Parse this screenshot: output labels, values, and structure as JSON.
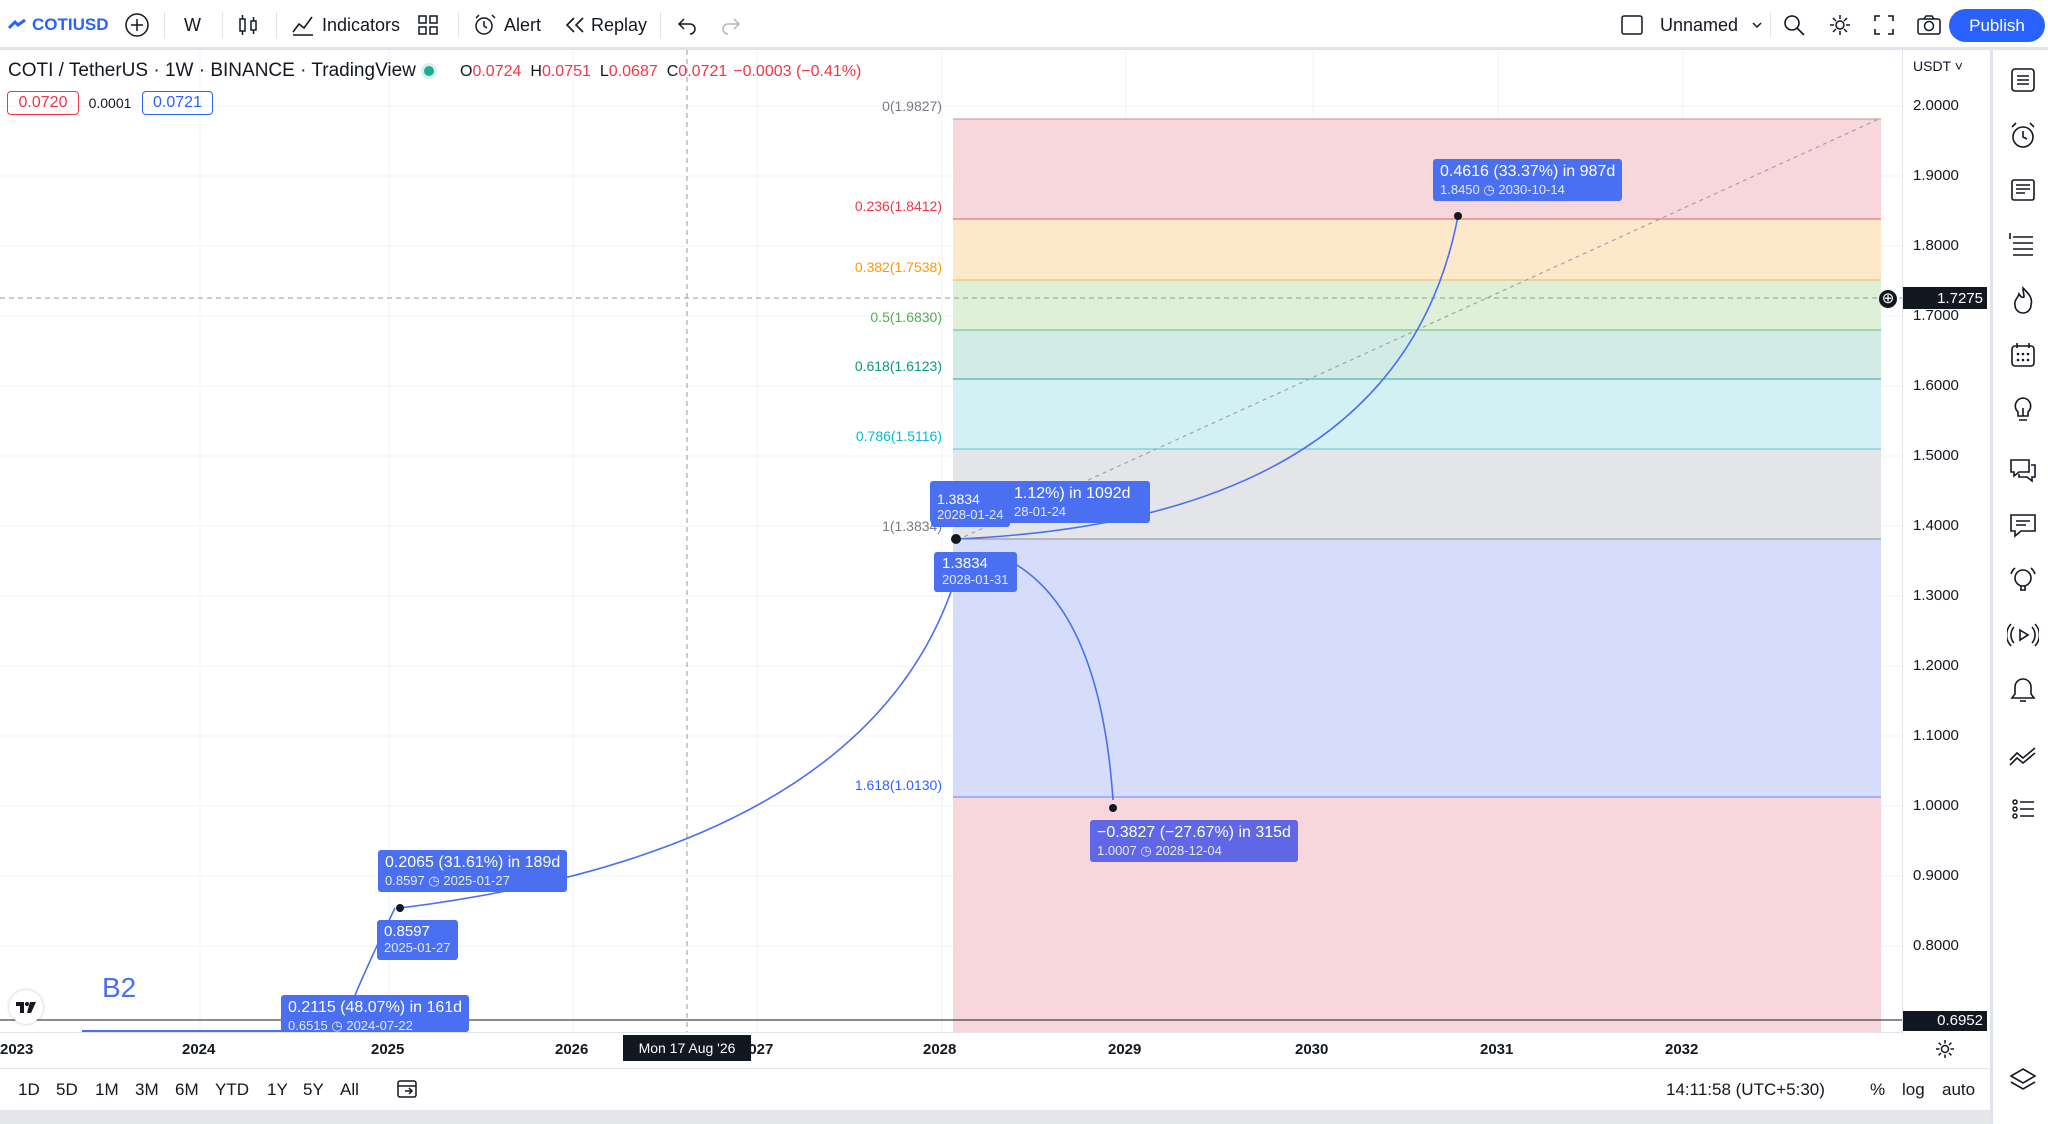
{
  "toolbar": {
    "symbol": "COTIUSD",
    "interval": "W",
    "indicators_label": "Indicators",
    "alert_label": "Alert",
    "replay_label": "Replay",
    "layout_name": "Unnamed",
    "publish_label": "Publish"
  },
  "legend": {
    "title": "COTI / TetherUS · 1W · BINANCE · TradingView",
    "o_key": "O",
    "o_val": "0.0724",
    "h_key": "H",
    "h_val": "0.0751",
    "l_key": "L",
    "l_val": "0.0687",
    "c_key": "C",
    "c_val": "0.0721",
    "change": "−0.0003 (−0.41%)",
    "bid": "0.0720",
    "spread": "0.0001",
    "ask": "0.0721"
  },
  "colors": {
    "up": "#22ab94",
    "down": "#f23645",
    "accent": "#2962ff",
    "tag": "#4a6ff0"
  },
  "price_axis": {
    "currency": "USDT",
    "ticks": [
      "2.0000",
      "1.9000",
      "1.8000",
      "1.7000",
      "1.6000",
      "1.5000",
      "1.4000",
      "1.3000",
      "1.2000",
      "1.1000",
      "1.0000",
      "0.9000",
      "0.8000"
    ],
    "crosshair_price": "1.7275",
    "last_price": "0.6952"
  },
  "time_axis": {
    "labels": [
      "2023",
      "2024",
      "2025",
      "2026",
      "2027",
      "2028",
      "2029",
      "2030",
      "2031",
      "2032"
    ],
    "crosshair_label": "Mon 17 Aug '26"
  },
  "fib_levels": [
    {
      "ratio": "0",
      "price": "1.9827",
      "label": "0(1.9827)",
      "color": "#787b86"
    },
    {
      "ratio": "0.236",
      "price": "1.8412",
      "label": "0.236(1.8412)",
      "color": "#f23645"
    },
    {
      "ratio": "0.382",
      "price": "1.7538",
      "label": "0.382(1.7538)",
      "color": "#ff9800"
    },
    {
      "ratio": "0.5",
      "price": "1.6830",
      "label": "0.5(1.6830)",
      "color": "#4caf50"
    },
    {
      "ratio": "0.618",
      "price": "1.6123",
      "label": "0.618(1.6123)",
      "color": "#089981"
    },
    {
      "ratio": "0.786",
      "price": "1.5116",
      "label": "0.786(1.5116)",
      "color": "#00bcd4"
    },
    {
      "ratio": "1",
      "price": "1.3834",
      "label": "1(1.3834)",
      "color": "#787b86"
    },
    {
      "ratio": "1.618",
      "price": "1.0130",
      "label": "1.618(1.0130)",
      "color": "#2962ff"
    }
  ],
  "annotations": [
    {
      "main": "0.4616 (33.37%) in 987d",
      "price": "1.8450",
      "date": "2030-10-14"
    },
    {
      "main": "1.12%) in 1092d",
      "date": "28-01-24"
    },
    {
      "main": "1.3834",
      "date": "2028-01-24"
    },
    {
      "main": "1.3834",
      "date": "2028-01-31"
    },
    {
      "main": "−0.3827 (−27.67%) in 315d",
      "price": "1.0007",
      "date": "2028-12-04"
    },
    {
      "main": "0.2065 (31.61%) in 189d",
      "price": "0.8597",
      "date": "2025-01-27"
    },
    {
      "main": "0.8597",
      "date": "2025-01-27"
    },
    {
      "main": "0.2115 (48.07%) in 161d",
      "price": "0.6515",
      "date": "2024-07-22"
    }
  ],
  "wave_label": "B2",
  "bottom": {
    "ranges": [
      "1D",
      "5D",
      "1M",
      "3M",
      "6M",
      "YTD",
      "1Y",
      "5Y",
      "All"
    ],
    "time": "14:11:58 (UTC+5:30)",
    "pct": "%",
    "log": "log",
    "auto": "auto"
  }
}
